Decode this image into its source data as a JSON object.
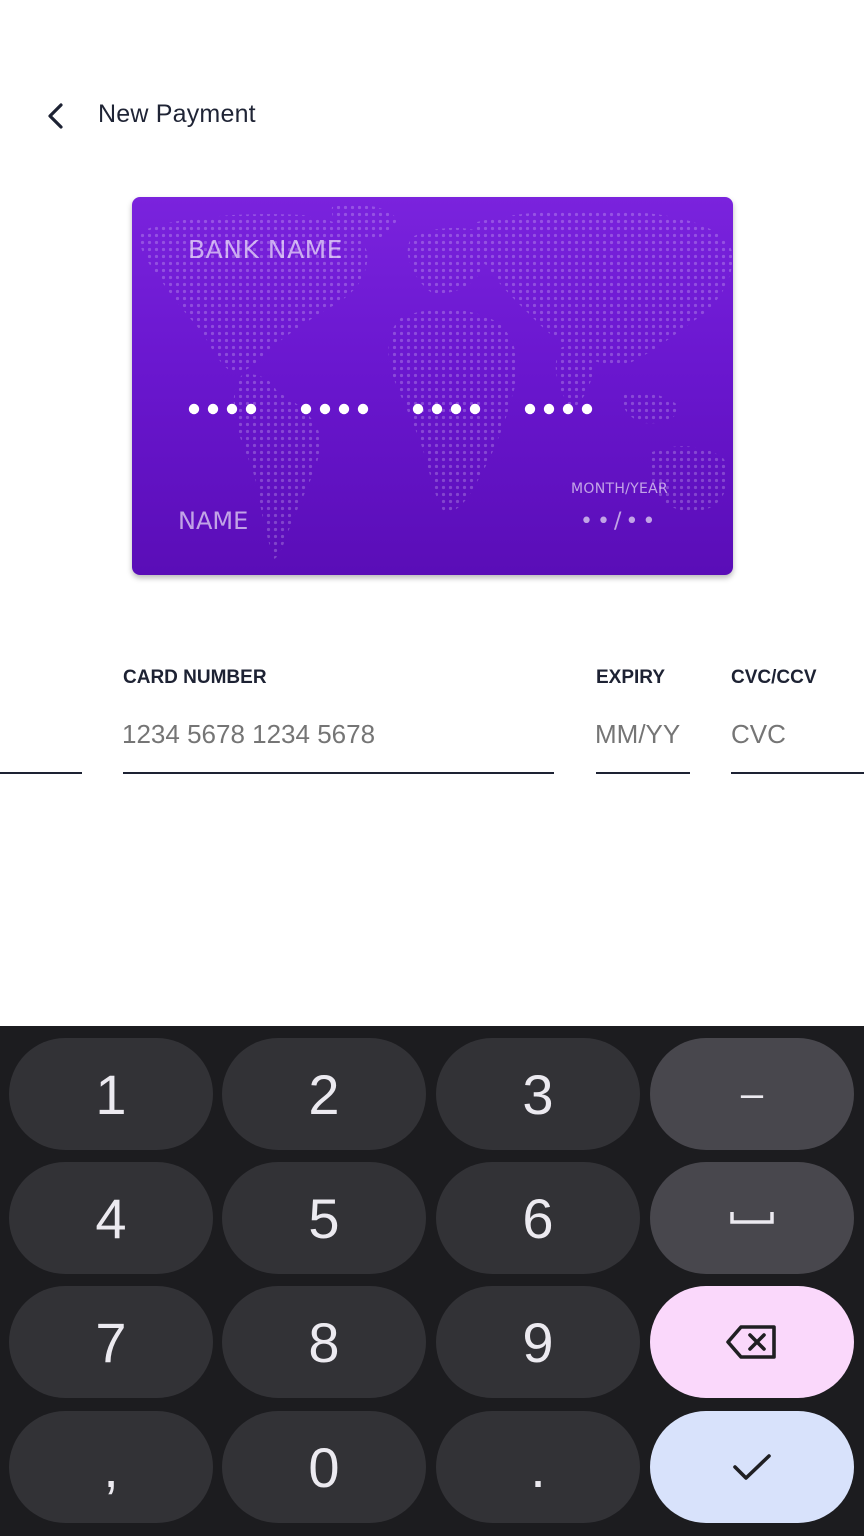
{
  "header": {
    "title": "New Payment"
  },
  "card": {
    "bank_name": "BANK  NAME",
    "number_mask": "•••• •••• •••• ••••",
    "holder_name": "NAME",
    "expiry_caption": "MONTH/YEAR",
    "expiry_mask": "••/••"
  },
  "form": {
    "card_number_label": "CARD NUMBER",
    "card_number_placeholder": "1234 5678 1234 5678",
    "expiry_label": "EXPIRY",
    "expiry_placeholder": "MM/YY",
    "cvc_label": "CVC/CCV",
    "cvc_placeholder": "CVC"
  },
  "keyboard": {
    "key_1": "1",
    "key_2": "2",
    "key_3": "3",
    "key_minus": "–",
    "key_4": "4",
    "key_5": "5",
    "key_6": "6",
    "key_7": "7",
    "key_8": "8",
    "key_9": "9",
    "key_comma": ",",
    "key_0": "0",
    "key_period": "."
  },
  "colors": {
    "card_gradient_top": "#7a23dd",
    "card_gradient_bottom": "#5a0db7",
    "keyboard_bg": "#1c1c1f",
    "key_bg": "#323236",
    "backspace_bg": "#fad8fb",
    "done_bg": "#d8e2fb"
  }
}
